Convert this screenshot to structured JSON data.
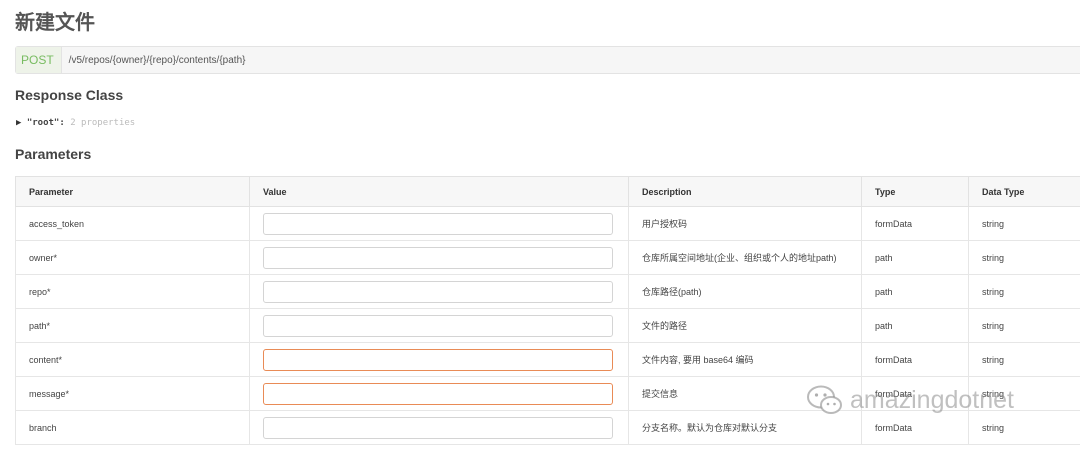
{
  "page": {
    "title": "新建文件"
  },
  "endpoint": {
    "method": "POST",
    "path": "/v5/repos/{owner}/{repo}/contents/{path}"
  },
  "response": {
    "section_title": "Response Class",
    "root_name": "\"root\":",
    "root_props": "2 properties"
  },
  "parameters": {
    "section_title": "Parameters",
    "headers": [
      "Parameter",
      "Value",
      "Description",
      "Type",
      "Data Type"
    ],
    "rows": [
      {
        "name": "access_token",
        "value": "",
        "description": "用户授权码",
        "type": "formData",
        "data_type": "string"
      },
      {
        "name": "owner*",
        "value": "",
        "description": "仓库所属空间地址(企业、组织或个人的地址path)",
        "type": "path",
        "data_type": "string"
      },
      {
        "name": "repo*",
        "value": "",
        "description": "仓库路径(path)",
        "type": "path",
        "data_type": "string"
      },
      {
        "name": "path*",
        "value": "",
        "description": "文件的路径",
        "type": "path",
        "data_type": "string"
      },
      {
        "name": "content*",
        "value": "",
        "description": "文件内容, 要用 base64 编码",
        "type": "formData",
        "data_type": "string"
      },
      {
        "name": "message*",
        "value": "",
        "description": "提交信息",
        "type": "formData",
        "data_type": "string"
      },
      {
        "name": "branch",
        "value": "",
        "description": "分支名称。默认为仓库对默认分支",
        "type": "formData",
        "data_type": "string"
      }
    ]
  },
  "watermark": {
    "text": "amazingdotnet",
    "icon": "wechat-icon"
  },
  "colors": {
    "method": "#78bc61",
    "error_border": "#e98b56"
  }
}
